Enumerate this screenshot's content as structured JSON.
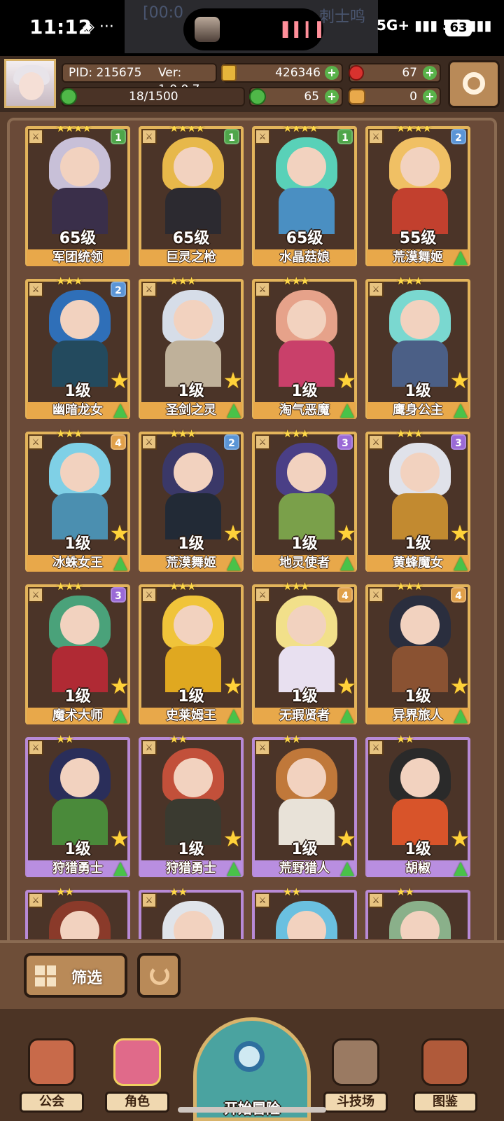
{
  "status_bar": {
    "time": "11:12",
    "left_icons": "◈ ···",
    "media_text": "[00:0",
    "media_text_tail": "刺士鸣",
    "network": "5G+ ▮▮▮ 5G ▮▮▮",
    "battery": "63"
  },
  "header": {
    "pid": "PID: 215675",
    "version": "Ver: 1.0.0.7",
    "gold": "426346",
    "gems": "67",
    "exp": "18/1500",
    "clover": "65",
    "bread": "0",
    "plus": "+"
  },
  "cards": [
    {
      "name": "军团统领",
      "level": "65级",
      "stars": "★★★★",
      "badge": "1",
      "badge_color": "#4fa64a",
      "hair": "#c8c0d8",
      "body": "#3a2f4a",
      "frame": "gold"
    },
    {
      "name": "巨灵之枪",
      "level": "65级",
      "stars": "★★★★",
      "badge": "1",
      "badge_color": "#4fa64a",
      "hair": "#e7b84a",
      "body": "#2c2a30",
      "frame": "gold"
    },
    {
      "name": "水晶菇娘",
      "level": "65级",
      "stars": "★★★★",
      "badge": "1",
      "badge_color": "#4fa64a",
      "hair": "#59d1b8",
      "body": "#4a8fc2",
      "frame": "gold"
    },
    {
      "name": "荒漠舞姬",
      "level": "55级",
      "stars": "★★★★",
      "badge": "2",
      "badge_color": "#5b95d6",
      "hair": "#f0c064",
      "body": "#c2402e",
      "frame": "gold",
      "upgrade": true
    },
    {
      "name": "幽暗龙女",
      "level": "1级",
      "stars": "★★★",
      "badge": "2",
      "badge_color": "#5b95d6",
      "hair": "#2f6fb8",
      "body": "#234a5e",
      "frame": "gold",
      "upgrade": true,
      "star": true
    },
    {
      "name": "圣剑之灵",
      "level": "1级",
      "stars": "★★★",
      "badge": "",
      "badge_color": "",
      "hair": "#d6dde8",
      "body": "#bfb19a",
      "frame": "gold",
      "upgrade": true,
      "star": true
    },
    {
      "name": "淘气恶魔",
      "level": "1级",
      "stars": "★★★",
      "badge": "",
      "badge_color": "",
      "hair": "#e6a28a",
      "body": "#c9406a",
      "frame": "gold",
      "upgrade": true,
      "star": true
    },
    {
      "name": "鹰身公主",
      "level": "1级",
      "stars": "★★★",
      "badge": "",
      "badge_color": "",
      "hair": "#7ad8d0",
      "body": "#4b5f86",
      "frame": "gold",
      "upgrade": true,
      "star": true
    },
    {
      "name": "冰蛛女王",
      "level": "1级",
      "stars": "★★★",
      "badge": "4",
      "badge_color": "#e0a04a",
      "hair": "#7fd0e6",
      "body": "#4b8fb0",
      "frame": "gold",
      "upgrade": true,
      "star": true
    },
    {
      "name": "荒漠舞姬",
      "level": "1级",
      "stars": "★★★",
      "badge": "2",
      "badge_color": "#5b95d6",
      "hair": "#3a3868",
      "body": "#222a36",
      "frame": "gold",
      "upgrade": true,
      "star": true
    },
    {
      "name": "地灵使者",
      "level": "1级",
      "stars": "★★★",
      "badge": "3",
      "badge_color": "#9a6ad6",
      "hair": "#4a3f86",
      "body": "#7aa04a",
      "frame": "gold",
      "upgrade": true,
      "star": true
    },
    {
      "name": "黄蜂魔女",
      "level": "1级",
      "stars": "★★★",
      "badge": "3",
      "badge_color": "#9a6ad6",
      "hair": "#e0e2ea",
      "body": "#c28a30",
      "frame": "gold",
      "upgrade": true,
      "star": true
    },
    {
      "name": "魔术大师",
      "level": "1级",
      "stars": "★★★",
      "badge": "3",
      "badge_color": "#9a6ad6",
      "hair": "#4aa27a",
      "body": "#b02a34",
      "frame": "gold",
      "upgrade": true,
      "star": true
    },
    {
      "name": "史莱姆王",
      "level": "1级",
      "stars": "★★★",
      "badge": "",
      "badge_color": "",
      "hair": "#f0c43a",
      "body": "#e0a820",
      "frame": "gold",
      "upgrade": true,
      "star": true
    },
    {
      "name": "无瑕贤者",
      "level": "1级",
      "stars": "★★★",
      "badge": "4",
      "badge_color": "#e0a04a",
      "hair": "#f2e08a",
      "body": "#e8e0f0",
      "frame": "gold",
      "upgrade": true,
      "star": true
    },
    {
      "name": "异界旅人",
      "level": "1级",
      "stars": "★★★",
      "badge": "4",
      "badge_color": "#e0a04a",
      "hair": "#2a2e3e",
      "body": "#8a5232",
      "frame": "gold",
      "upgrade": true,
      "star": true
    },
    {
      "name": "狩猎勇士",
      "level": "1级",
      "stars": "★★",
      "badge": "",
      "badge_color": "",
      "hair": "#2a2e5a",
      "body": "#4a8a3a",
      "frame": "purple",
      "upgrade": true,
      "star": true
    },
    {
      "name": "狩猎勇士",
      "level": "1级",
      "stars": "★★",
      "badge": "",
      "badge_color": "",
      "hair": "#c2503a",
      "body": "#3a3a30",
      "frame": "purple",
      "upgrade": true,
      "star": true
    },
    {
      "name": "荒野猎人",
      "level": "1级",
      "stars": "★★",
      "badge": "",
      "badge_color": "",
      "hair": "#c0783a",
      "body": "#e8e2d8",
      "frame": "purple",
      "upgrade": true,
      "star": true
    },
    {
      "name": "胡椒",
      "level": "1级",
      "stars": "★★",
      "badge": "",
      "badge_color": "",
      "hair": "#2a2a2a",
      "body": "#d8542a",
      "frame": "purple",
      "upgrade": true,
      "star": true
    },
    {
      "name": "",
      "level": "",
      "stars": "★★",
      "badge": "",
      "badge_color": "",
      "hair": "#8a3a2a",
      "body": "#5ab0d0",
      "frame": "purple"
    },
    {
      "name": "",
      "level": "",
      "stars": "★★",
      "badge": "",
      "badge_color": "",
      "hair": "#e0e4ea",
      "body": "#6a5a6a",
      "frame": "purple"
    },
    {
      "name": "",
      "level": "",
      "stars": "★★",
      "badge": "",
      "badge_color": "",
      "hair": "#6ac0e0",
      "body": "#3a6a9a",
      "frame": "purple"
    },
    {
      "name": "",
      "level": "",
      "stars": "★★",
      "badge": "",
      "badge_color": "",
      "hair": "#8ab08a",
      "body": "#4a6a5a",
      "frame": "purple"
    }
  ],
  "toolbar": {
    "filter_label": "筛选"
  },
  "nav": {
    "guild": "公会",
    "characters": "角色",
    "start": "开始冒险",
    "arena": "斗技场",
    "codex": "图鉴"
  },
  "icons": {
    "settings": "gear-icon",
    "filter": "grid-icon",
    "reset": "refresh-icon"
  }
}
